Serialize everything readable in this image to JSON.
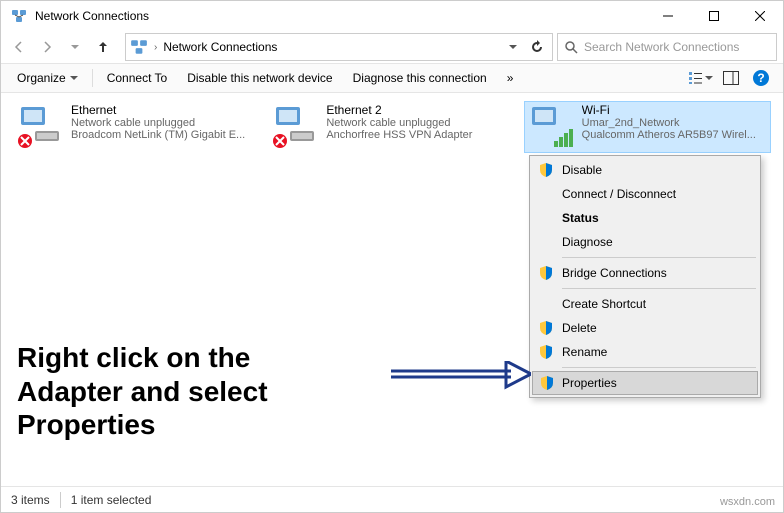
{
  "window": {
    "title": "Network Connections"
  },
  "nav": {
    "breadcrumb": "Network Connections",
    "search_placeholder": "Search Network Connections"
  },
  "toolbar": {
    "organize": "Organize",
    "connect": "Connect To",
    "disable": "Disable this network device",
    "diagnose": "Diagnose this connection"
  },
  "adapters": [
    {
      "name": "Ethernet",
      "status": "Network cable unplugged",
      "device": "Broadcom NetLink (TM) Gigabit E...",
      "type": "eth",
      "error": true
    },
    {
      "name": "Ethernet 2",
      "status": "Network cable unplugged",
      "device": "Anchorfree HSS VPN Adapter",
      "type": "eth",
      "error": true
    },
    {
      "name": "Wi-Fi",
      "status": "Umar_2nd_Network",
      "device": "Qualcomm Atheros AR5B97 Wirel...",
      "type": "wifi",
      "error": false,
      "selected": true
    }
  ],
  "context_menu": {
    "disable": "Disable",
    "connect": "Connect / Disconnect",
    "status": "Status",
    "diagnose": "Diagnose",
    "bridge": "Bridge Connections",
    "shortcut": "Create Shortcut",
    "delete": "Delete",
    "rename": "Rename",
    "properties": "Properties"
  },
  "annotation": {
    "line1": "Right click on the",
    "line2": "Adapter and select",
    "line3": "Properties"
  },
  "status": {
    "count": "3 items",
    "selected": "1 item selected"
  },
  "watermark": "wsxdn.com"
}
